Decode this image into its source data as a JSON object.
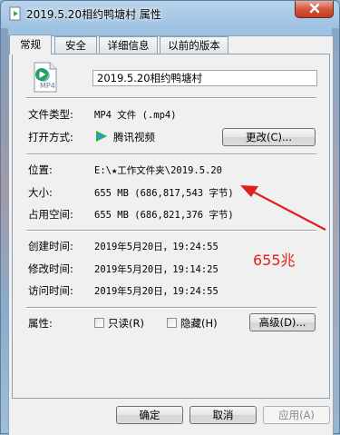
{
  "window": {
    "title": "2019.5.20相约鸭塘村 属性",
    "close_icon": "close-icon"
  },
  "tabs": [
    {
      "label": "常规",
      "active": true
    },
    {
      "label": "安全",
      "active": false
    },
    {
      "label": "详细信息",
      "active": false
    },
    {
      "label": "以前的版本",
      "active": false
    }
  ],
  "general": {
    "file_icon_caption": "MP4",
    "file_name": "2019.5.20相约鸭塘村",
    "type_label": "文件类型:",
    "type_value": "MP4 文件 (.mp4)",
    "opens_with_label": "打开方式:",
    "opens_with_app": "腾讯视频",
    "change_button": "更改(C)...",
    "location_label": "位置:",
    "location_value": "E:\\★工作文件夹\\2019.5.20",
    "size_label": "大小:",
    "size_value": "655 MB (686,817,543 字节)",
    "size_on_disk_label": "占用空间:",
    "size_on_disk_value": "655 MB (686,821,376 字节)",
    "created_label": "创建时间:",
    "created_value": "2019年5月20日，19:24:55",
    "modified_label": "修改时间:",
    "modified_value": "2019年5月20日，19:14:25",
    "accessed_label": "访问时间:",
    "accessed_value": "2019年5月20日，19:24:55",
    "attributes_label": "属性:",
    "readonly_label": "只读(R)",
    "hidden_label": "隐藏(H)",
    "advanced_button": "高级(D)..."
  },
  "annotation": {
    "text": "655兆",
    "color": "#e0201c"
  },
  "buttons": {
    "ok": "确定",
    "cancel": "取消",
    "apply": "应用(A)"
  }
}
